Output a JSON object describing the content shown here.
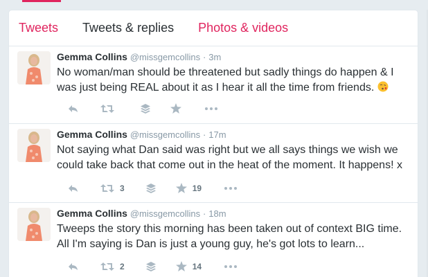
{
  "tabs": [
    {
      "label": "Tweets"
    },
    {
      "label": "Tweets & replies"
    },
    {
      "label": "Photos & videos"
    }
  ],
  "tweets": [
    {
      "name": "Gemma Collins",
      "handle": "@missgemcollins",
      "separator": "·",
      "time": "3m",
      "text": "No woman/man should be threatened but sadly things do happen & I was just being REAL about it as I hear it all the time from friends.",
      "emoji": "kissing-face-emoji",
      "retweets": "",
      "favorites": ""
    },
    {
      "name": "Gemma Collins",
      "handle": "@missgemcollins",
      "separator": "·",
      "time": "17m",
      "text": "Not saying what Dan said was right but we all says things we wish we could take back that come out in the heat of the moment. It happens! x",
      "retweets": "3",
      "favorites": "19"
    },
    {
      "name": "Gemma Collins",
      "handle": "@missgemcollins",
      "separator": "·",
      "time": "18m",
      "text": "Tweeps the story this morning has been taken out of context BIG time. All I'm saying is Dan is just a young guy, he's got lots to learn...",
      "retweets": "2",
      "favorites": "14"
    }
  ],
  "icons": {
    "reply": "reply-icon",
    "retweet": "retweet-icon",
    "buffer": "buffer-icon",
    "favorite": "star-icon",
    "more": "more-icon"
  },
  "colors": {
    "accent": "#e0245e",
    "text": "#292f33",
    "muted": "#8899a6",
    "background": "#e6ecf0"
  }
}
